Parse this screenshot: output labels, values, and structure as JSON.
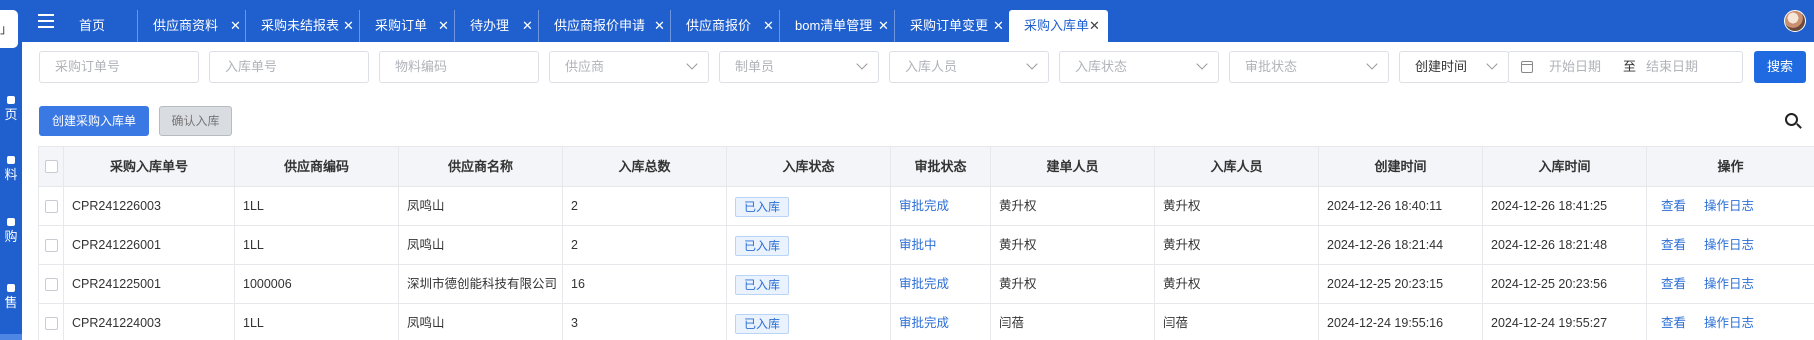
{
  "sidebar": {
    "logo_text": "」",
    "items": [
      {
        "label": "页"
      },
      {
        "label": "料"
      },
      {
        "label": "购"
      },
      {
        "label": "售"
      }
    ]
  },
  "tabs": [
    {
      "label": "首页",
      "closable": false
    },
    {
      "label": "供应商资料",
      "closable": true
    },
    {
      "label": "采购未结报表",
      "closable": true
    },
    {
      "label": "采购订单",
      "closable": true
    },
    {
      "label": "待办理",
      "closable": true
    },
    {
      "label": "供应商报价申请",
      "closable": true
    },
    {
      "label": "供应商报价",
      "closable": true
    },
    {
      "label": "bom清单管理",
      "closable": true
    },
    {
      "label": "采购订单变更",
      "closable": true
    },
    {
      "label": "采购入库单",
      "closable": true,
      "active": true
    }
  ],
  "filters": {
    "po_number": "采购订单号",
    "receipt_number": "入库单号",
    "material_code": "物料编码",
    "supplier": "供应商",
    "creator": "制单员",
    "receiver": "入库人员",
    "receipt_status": "入库状态",
    "approval_status": "审批状态",
    "date_type": "创建时间",
    "start_date": "开始日期",
    "range_sep": "至",
    "end_date": "结束日期",
    "search_button": "搜索"
  },
  "actions": {
    "create": "创建采购入库单",
    "confirm": "确认入库"
  },
  "table": {
    "columns": [
      "采购入库单号",
      "供应商编码",
      "供应商名称",
      "入库总数",
      "入库状态",
      "审批状态",
      "建单人员",
      "入库人员",
      "创建时间",
      "入库时间",
      "操作"
    ],
    "rows": [
      {
        "no": "CPR241226003",
        "supplier_code": "1LL",
        "supplier_name": "凤鸣山",
        "total": "2",
        "status": "已入库",
        "approval": "审批完成",
        "creator": "黄升权",
        "receiver": "黄升权",
        "created": "2024-12-26 18:40:11",
        "received": "2024-12-26 18:41:25",
        "view": "查看",
        "log": "操作日志"
      },
      {
        "no": "CPR241226001",
        "supplier_code": "1LL",
        "supplier_name": "凤鸣山",
        "total": "2",
        "status": "已入库",
        "approval": "审批中",
        "creator": "黄升权",
        "receiver": "黄升权",
        "created": "2024-12-26 18:21:44",
        "received": "2024-12-26 18:21:48",
        "view": "查看",
        "log": "操作日志"
      },
      {
        "no": "CPR241225001",
        "supplier_code": "1000006",
        "supplier_name": "深圳市德创能科技有限公司",
        "total": "16",
        "status": "已入库",
        "approval": "审批完成",
        "creator": "黄升权",
        "receiver": "黄升权",
        "created": "2024-12-25 20:23:15",
        "received": "2024-12-25 20:23:56",
        "view": "查看",
        "log": "操作日志"
      },
      {
        "no": "CPR241224003",
        "supplier_code": "1LL",
        "supplier_name": "凤鸣山",
        "total": "3",
        "status": "已入库",
        "approval": "审批完成",
        "creator": "闫蓓",
        "receiver": "闫蓓",
        "created": "2024-12-24 19:55:16",
        "received": "2024-12-24 19:55:27",
        "view": "查看",
        "log": "操作日志"
      }
    ]
  },
  "colors": {
    "brand": "#1f5fce",
    "primary_button": "#3a78e4",
    "link": "#2b6fd6"
  }
}
